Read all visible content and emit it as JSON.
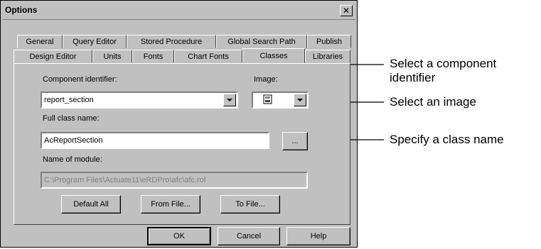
{
  "window": {
    "title": "Options",
    "close_glyph": "✕"
  },
  "tabs_row1": [
    "General",
    "Query Editor",
    "Stored Procedure",
    "Global Search Path",
    "Publish"
  ],
  "tabs_row2": [
    "Design Editor",
    "Units",
    "Fonts",
    "Chart Fonts",
    "Classes",
    "Libraries"
  ],
  "active_tab": "Classes",
  "form": {
    "component_identifier_label": "Component identifier:",
    "component_identifier_value": "report_section",
    "image_label": "Image:",
    "full_class_name_label": "Full class name:",
    "full_class_name_value": "AcReportSection",
    "browse_label": "...",
    "module_label": "Name of module:",
    "module_value": "C:\\Program Files\\Actuate11\\eRDPro\\afc\\afc.rol"
  },
  "buttons": {
    "default_all": "Default All",
    "from_file": "From File...",
    "to_file": "To File...",
    "ok": "OK",
    "cancel": "Cancel",
    "help": "Help"
  },
  "callouts": {
    "component": "Select a component identifier",
    "component_line1": "Select a component",
    "component_line2": "identifier",
    "image": "Select an image",
    "class_name": "Specify a class name"
  }
}
